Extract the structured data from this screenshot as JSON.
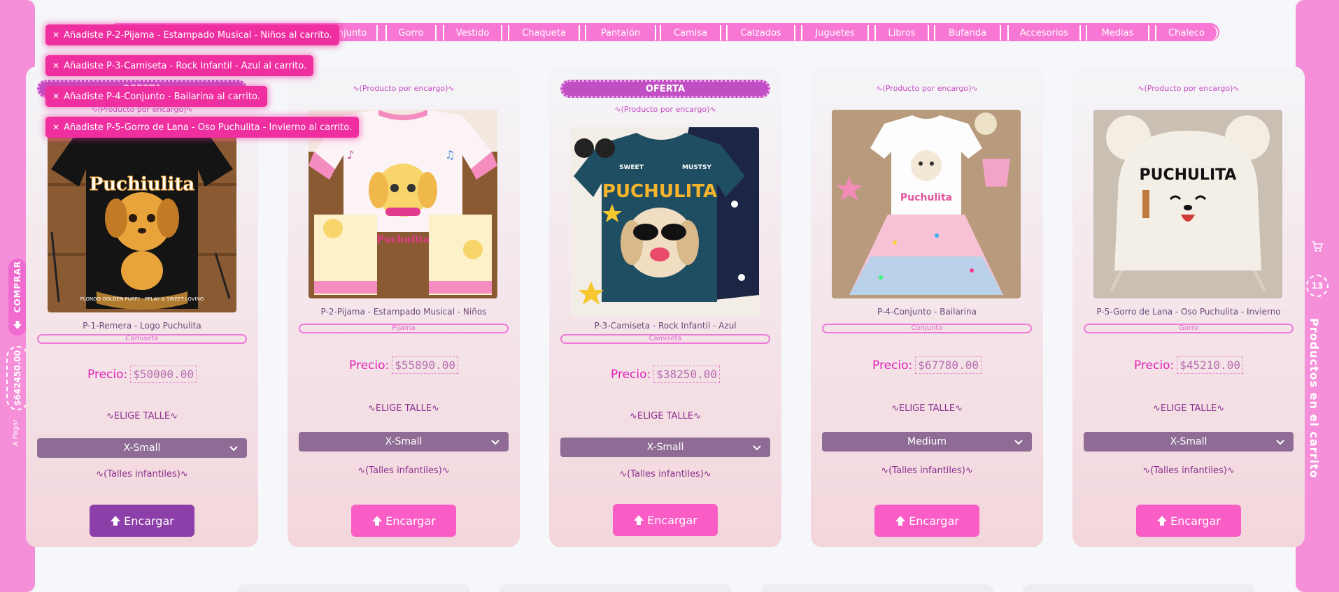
{
  "sidebar_left": {
    "buy_label": "COMPRAR",
    "total": "$642450.00",
    "to_pay_label": "A Pagar"
  },
  "sidebar_right": {
    "cart_count": "13",
    "title": "Productos en el carrito"
  },
  "categories": [
    "Conjunto",
    "Gorro",
    "Vestido",
    "Chaqueta",
    "Pantalón",
    "Camisa",
    "Calzados",
    "Juguetes",
    "Libros",
    "Bufanda",
    "Accesorios",
    "Medias",
    "Chaleco"
  ],
  "toasts": [
    "Añadiste P-2-Pijama - Estampado Musical - Niños al carrito.",
    "Añadiste P-3-Camiseta - Rock Infantil - Azul al carrito.",
    "Añadiste P-4-Conjunto - Bailarina al carrito.",
    "Añadiste P-5-Gorro de Lana - Oso Puchulita - Invierno al carrito."
  ],
  "products": [
    {
      "offer": "OFERTA",
      "by_order": "∿(Producto por encargo)∿",
      "name": "P-1-Remera - Logo Puchulita",
      "tag": "Camiseta",
      "price_label": "Precio:",
      "price": "$50000.00",
      "size_title": "∿ELIGE TALLE∿",
      "size": "X-Small",
      "size_note": "∿(Talles infantiles)∿",
      "button": "Encargar"
    },
    {
      "offer": "",
      "by_order": "∿(Producto por encargo)∿",
      "name": "P-2-Pijama - Estampado Musical - Niños",
      "tag": "Pijama",
      "price_label": "Precio:",
      "price": "$55890.00",
      "size_title": "∿ELIGE TALLE∿",
      "size": "X-Small",
      "size_note": "∿(Talles infantiles)∿",
      "button": "Encargar"
    },
    {
      "offer": "OFERTA",
      "by_order": "∿(Producto por encargo)∿",
      "name": "P-3-Camiseta - Rock Infantil - Azul",
      "tag": "Camiseta",
      "price_label": "Precio:",
      "price": "$38250.00",
      "size_title": "∿ELIGE TALLE∿",
      "size": "X-Small",
      "size_note": "∿(Talles infantiles)∿",
      "button": "Encargar"
    },
    {
      "offer": "",
      "by_order": "∿(Producto por encargo)∿",
      "name": "P-4-Conjunto - Bailarina",
      "tag": "Conjunto",
      "price_label": "Precio:",
      "price": "$67780.00",
      "size_title": "∿ELIGE TALLE∿",
      "size": "Medium",
      "size_note": "∿(Talles infantiles)∿",
      "button": "Encargar"
    },
    {
      "offer": "",
      "by_order": "∿(Producto por encargo)∿",
      "name": "P-5-Gorro de Lana - Oso Puchulita - Invierno",
      "tag": "Gorro",
      "price_label": "Precio:",
      "price": "$45210.00",
      "size_title": "∿ELIGE TALLE∿",
      "size": "X-Small",
      "size_note": "∿(Talles infantiles)∿",
      "button": "Encargar"
    }
  ],
  "image_text": {
    "p1_logo": "Puchiulita",
    "p1_sub": "PLONDO GOLDEN PUPPY · PPLAY & SWEET LOVING",
    "p2_logo": "Puchulita",
    "p3_top_left": "SWEET",
    "p3_top_right": "MUSTSY",
    "p3_logo": "PUCHULITA",
    "p4_logo": "Puchulita",
    "p5_logo": "PUCHULITA"
  },
  "colors": {
    "accent": "#f877d4",
    "sidebar": "#f58fd9",
    "button": "#fa5ec6",
    "button_active": "#8c3fa8",
    "select": "#8f6c95"
  }
}
